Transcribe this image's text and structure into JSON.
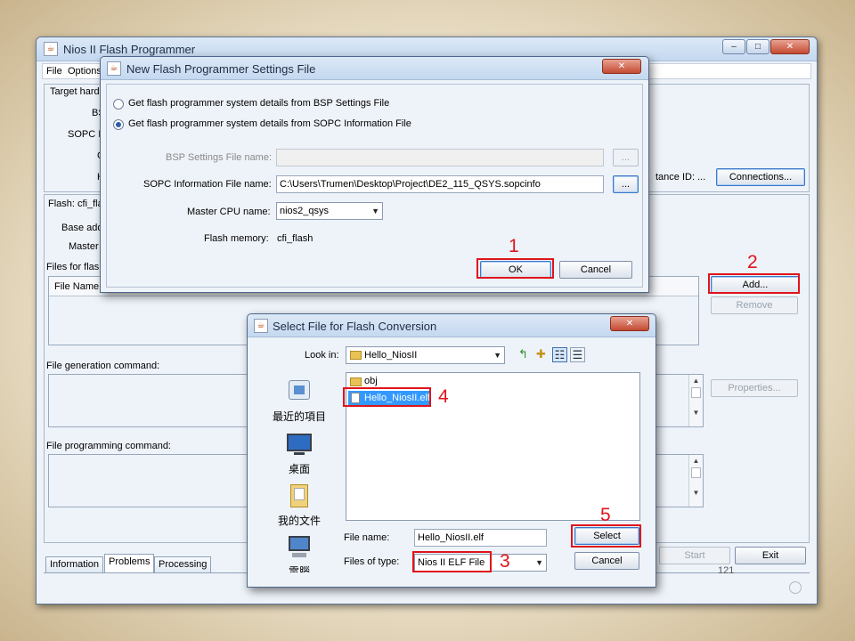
{
  "main_window": {
    "title": "Nios II Flash Programmer",
    "menu": [
      "File",
      "Options"
    ],
    "target_hardware_label": "Target hard",
    "bsp_label": "BSP",
    "sopc_label": "SOPC In",
    "c_label": "C",
    "h_label": "H",
    "instance_id_label": "tance ID: ...",
    "connections_button": "Connections...",
    "flash_label": "Flash: cfi_fla",
    "base_address_label": "Base add",
    "master_label": "Master",
    "files_for_flash_label": "Files for flas",
    "file_name_col": "File Name",
    "add_button": "Add...",
    "remove_button": "Remove",
    "properties_button": "Properties...",
    "file_generation_label": "File generation command:",
    "file_programming_label": "File programming command:",
    "tabs": [
      "Information",
      "Problems",
      "Processing"
    ],
    "start_button": "Start",
    "exit_button": "Exit",
    "page_number": "121"
  },
  "settings_dialog": {
    "title": "New Flash Programmer Settings File",
    "radio_bsp": "Get flash programmer system details from BSP Settings File",
    "radio_sopc": "Get flash programmer system details from SOPC Information File",
    "bsp_file_label": "BSP Settings File name:",
    "bsp_browse": "...",
    "sopc_file_label": "SOPC Information File name:",
    "sopc_file_value": "C:\\Users\\Trumen\\Desktop\\Project\\DE2_115_QSYS.sopcinfo",
    "sopc_browse": "...",
    "master_cpu_label": "Master CPU name:",
    "master_cpu_value": "nios2_qsys",
    "flash_memory_label": "Flash memory:",
    "flash_memory_value": "cfi_flash",
    "ok_button": "OK",
    "cancel_button": "Cancel"
  },
  "select_file_dialog": {
    "title": "Select File for Flash Conversion",
    "look_in_label": "Look in:",
    "look_in_value": "Hello_NiosII",
    "places": [
      "最近的項目",
      "桌面",
      "我的文件",
      "電腦"
    ],
    "files": [
      {
        "name": "obj",
        "type": "folder"
      },
      {
        "name": "Hello_NiosII.elf",
        "type": "file"
      }
    ],
    "file_name_label": "File name:",
    "file_name_value": "Hello_NiosII.elf",
    "files_of_type_label": "Files of type:",
    "files_of_type_value": "Nios II ELF File",
    "select_button": "Select",
    "cancel_button": "Cancel"
  },
  "annotations": [
    "1",
    "2",
    "3",
    "4",
    "5"
  ],
  "colors": {
    "annotation_red": "#e0141c",
    "selection_blue": "#3399ff",
    "window_bg": "#eef3f9"
  }
}
